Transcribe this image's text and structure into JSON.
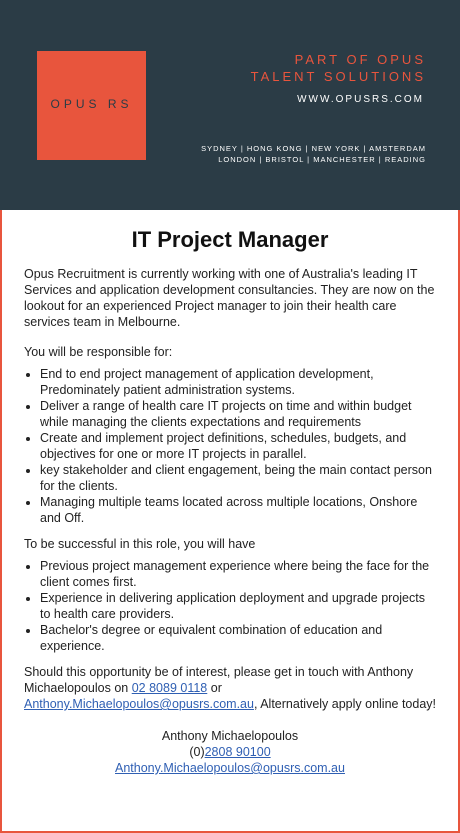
{
  "header": {
    "logo_text": "OPUS RS",
    "tagline_line1": "PART OF OPUS",
    "tagline_line2": "TALENT SOLUTIONS",
    "website": "WWW.OPUSRS.COM",
    "locations_line1": "SYDNEY | HONG KONG | NEW YORK | AMSTERDAM",
    "locations_line2": "LONDON | BRISTOL | MANCHESTER | READING",
    "colors": {
      "background": "#2b3c46",
      "accent": "#e8553d"
    }
  },
  "job": {
    "title": "IT Project Manager",
    "intro": "Opus Recruitment is currently working with one of Australia's leading IT Services and application development consultancies. They are now on the lookout for an experienced Project manager to join their health care services team in Melbourne.",
    "responsible_heading": "You will be responsible for:",
    "responsibilities": [
      "End to end project management of application development, Predominately patient administration systems.",
      "Deliver a range of health care IT projects on time and within budget while managing the clients expectations and requirements",
      "Create and implement project definitions, schedules, budgets, and objectives for one or more IT projects in parallel.",
      "key stakeholder and client engagement, being the main contact person for the clients.",
      "Managing multiple teams located across multiple locations, Onshore and Off."
    ],
    "success_heading": "To be successful in this role, you will have",
    "requirements": [
      "Previous project management experience where being the face for the client comes first.",
      "Experience in delivering application deployment and upgrade projects to health care providers.",
      "Bachelor's degree or equivalent combination of education and experience."
    ],
    "closing": {
      "text_before": "Should this opportunity be of interest, please get in touch with Anthony Michaelopoulos on ",
      "phone_link": "02 8089 0118",
      "text_or": " or ",
      "email_link": "Anthony.Michaelopoulos@opusrs.com.au",
      "text_after": ", Alternatively apply online today!"
    },
    "contact": {
      "name": "Anthony Michaelopoulos",
      "phone_prefix": "(0)",
      "phone_link": "2808 90100",
      "email": "Anthony.Michaelopoulos@opusrs.com.au"
    }
  }
}
